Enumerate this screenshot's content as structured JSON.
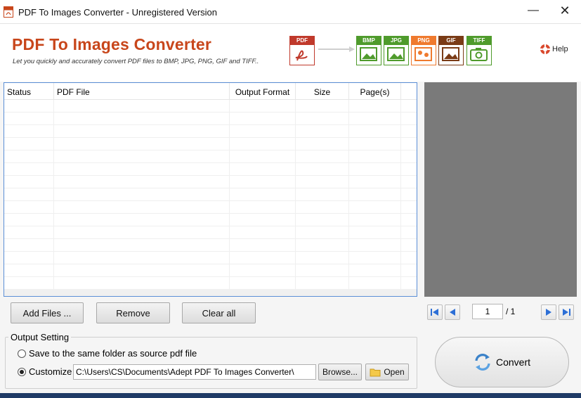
{
  "window": {
    "title": "PDF To Images Converter - Unregistered Version",
    "minimize_glyph": "—",
    "close_glyph": "✕"
  },
  "header": {
    "app_name": "PDF To Images Converter",
    "tagline": "Let you quickly and accurately convert PDF files to  BMP, JPG, PNG, GIF and TIFF..",
    "help_label": "Help",
    "formats": {
      "source": "PDF",
      "targets": [
        {
          "label": "BMP",
          "color": "#4f9b2c"
        },
        {
          "label": "JPG",
          "color": "#4f9b2c"
        },
        {
          "label": "PNG",
          "color": "#ef7a2e"
        },
        {
          "label": "GIF",
          "color": "#7a3b16"
        },
        {
          "label": "TIFF",
          "color": "#4f9b2c"
        }
      ]
    }
  },
  "file_table": {
    "columns": [
      "Status",
      "PDF File",
      "Output Format",
      "Size",
      "Page(s)"
    ],
    "rows": []
  },
  "file_buttons": {
    "add": "Add Files ...",
    "remove": "Remove",
    "clear": "Clear all"
  },
  "pager": {
    "current_page": "1",
    "total_label": "/ 1"
  },
  "output_setting": {
    "legend": "Output Setting",
    "option_same": "Save to the same folder as source pdf file",
    "option_custom": "Customize",
    "selected": "custom",
    "path": "C:\\Users\\CS\\Documents\\Adept PDF To Images Converter\\",
    "browse_label": "Browse...",
    "open_label": "Open"
  },
  "convert_label": "Convert",
  "colors": {
    "accent": "#c8461b",
    "table_border": "#5b8fd6",
    "preview_bg": "#7a7a7a",
    "nav_blue": "#2d6fd6"
  }
}
